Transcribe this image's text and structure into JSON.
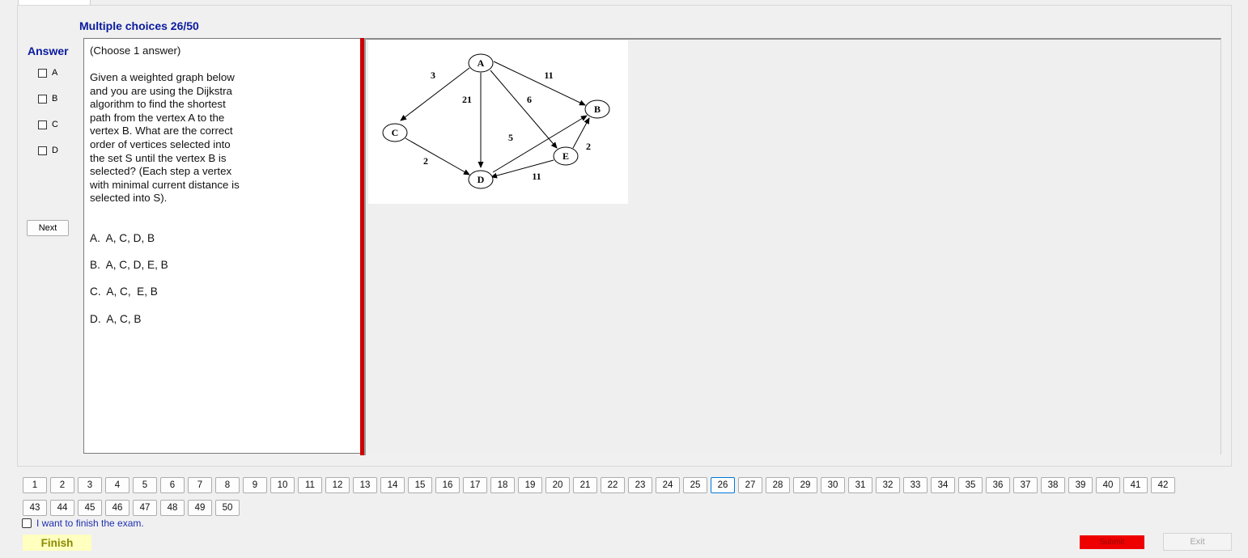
{
  "question_title": "Multiple choices 26/50",
  "answer_label": "Answer",
  "answer_options": [
    "A",
    "B",
    "C",
    "D"
  ],
  "next_label": "Next",
  "question": {
    "instruction": "(Choose 1 answer)",
    "body_lines": [
      "Given a weighted graph below",
      "and you are using the Dijkstra",
      "algorithm to find the shortest",
      "path from the vertex  A  to the",
      "vertex  B. What are the correct",
      "order of vertices selected into",
      "the set  S until the vertex  B  is",
      "selected? (Each step a vertex",
      "with minimal current distance is",
      "selected into S)."
    ],
    "choices": [
      "A.  A, C, D, B",
      "B.  A, C, D, E, B",
      "C.  A, C,  E, B",
      "D.  A, C, B"
    ]
  },
  "graph": {
    "nodes": [
      "A",
      "B",
      "C",
      "D",
      "E"
    ],
    "edge_weights": [
      "3",
      "11",
      "21",
      "6",
      "5",
      "2",
      "2",
      "11"
    ]
  },
  "question_numbers": [
    "1",
    "2",
    "3",
    "4",
    "5",
    "6",
    "7",
    "8",
    "9",
    "10",
    "11",
    "12",
    "13",
    "14",
    "15",
    "16",
    "17",
    "18",
    "19",
    "20",
    "21",
    "22",
    "23",
    "24",
    "25",
    "26",
    "27",
    "28",
    "29",
    "30",
    "31",
    "32",
    "33",
    "34",
    "35",
    "36",
    "37",
    "38",
    "39",
    "40",
    "41",
    "42",
    "43",
    "44",
    "45",
    "46",
    "47",
    "48",
    "49",
    "50"
  ],
  "current_question": "26",
  "finish_checkbox_label": "I want to finish the exam.",
  "finish_label": "Finish",
  "submit_label": "Submit",
  "exit_label": "Exit",
  "colors": {
    "title": "#0a1a9e",
    "splitter": "#cc0000",
    "submit": "#ee0000",
    "finish_bg": "#ffffc0"
  }
}
